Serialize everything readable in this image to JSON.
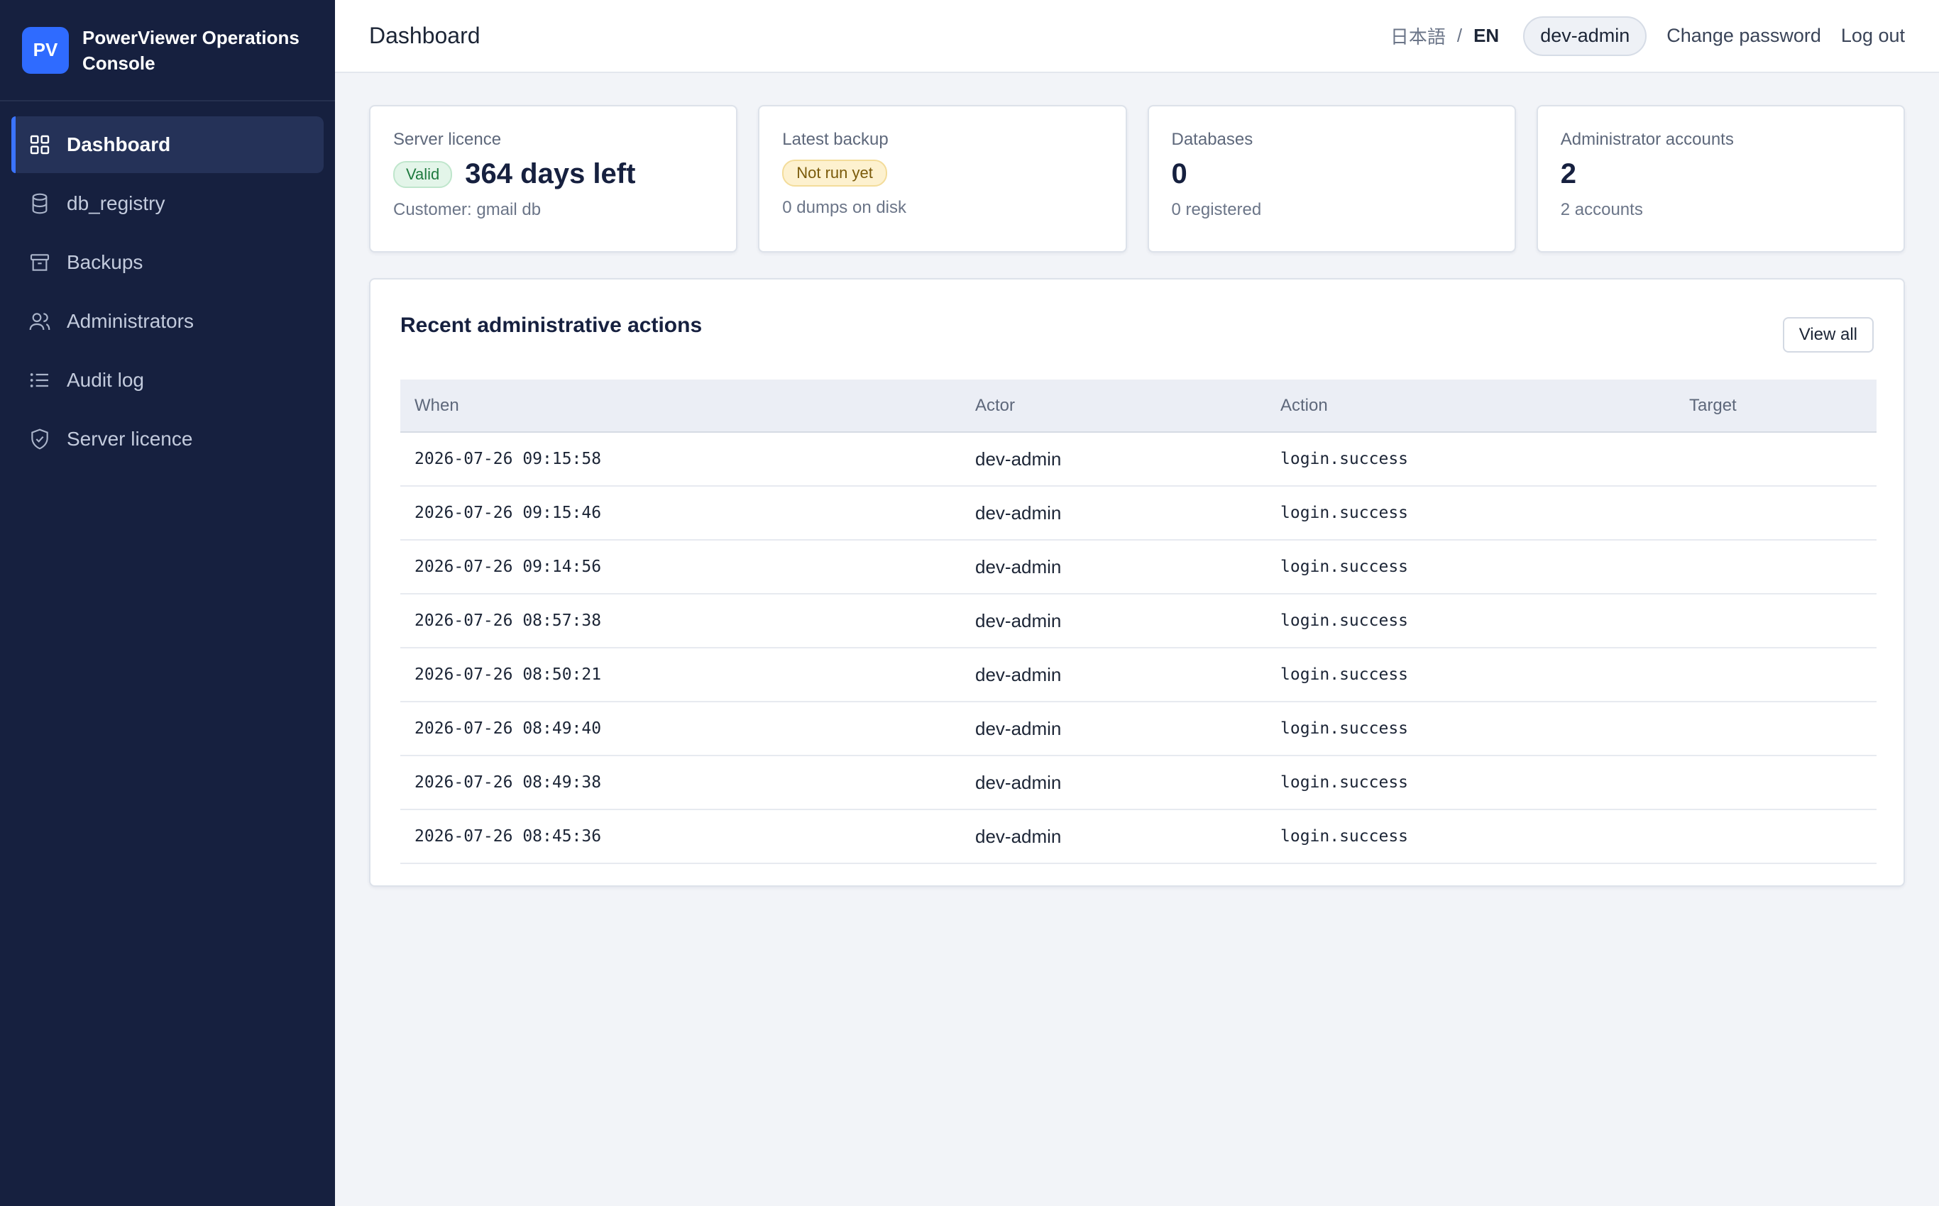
{
  "brand": {
    "logo_text": "PV",
    "name": "PowerViewer Operations Console"
  },
  "sidebar": {
    "items": [
      {
        "label": "Dashboard",
        "icon": "grid-icon",
        "active": true
      },
      {
        "label": "db_registry",
        "icon": "database-icon",
        "active": false
      },
      {
        "label": "Backups",
        "icon": "archive-icon",
        "active": false
      },
      {
        "label": "Administrators",
        "icon": "users-icon",
        "active": false
      },
      {
        "label": "Audit log",
        "icon": "list-icon",
        "active": false
      },
      {
        "label": "Server licence",
        "icon": "shield-check-icon",
        "active": false
      }
    ]
  },
  "header": {
    "title": "Dashboard",
    "lang_ja": "日本語",
    "lang_sep": "/",
    "lang_en": "EN",
    "user": "dev-admin",
    "change_password": "Change password",
    "logout": "Log out"
  },
  "cards": {
    "licence": {
      "label": "Server licence",
      "badge": "Valid",
      "value": "364 days left",
      "sub": "Customer: gmail db"
    },
    "backup": {
      "label": "Latest backup",
      "badge": "Not run yet",
      "sub": "0 dumps on disk"
    },
    "databases": {
      "label": "Databases",
      "value": "0",
      "sub": "0 registered"
    },
    "admins": {
      "label": "Administrator accounts",
      "value": "2",
      "sub": "2 accounts"
    }
  },
  "recent": {
    "title": "Recent administrative actions",
    "view_all": "View all",
    "columns": [
      "When",
      "Actor",
      "Action",
      "Target"
    ],
    "rows": [
      {
        "when": "2026-07-26 09:15:58",
        "actor": "dev-admin",
        "action": "login.success",
        "target": ""
      },
      {
        "when": "2026-07-26 09:15:46",
        "actor": "dev-admin",
        "action": "login.success",
        "target": ""
      },
      {
        "when": "2026-07-26 09:14:56",
        "actor": "dev-admin",
        "action": "login.success",
        "target": ""
      },
      {
        "when": "2026-07-26 08:57:38",
        "actor": "dev-admin",
        "action": "login.success",
        "target": ""
      },
      {
        "when": "2026-07-26 08:50:21",
        "actor": "dev-admin",
        "action": "login.success",
        "target": ""
      },
      {
        "when": "2026-07-26 08:49:40",
        "actor": "dev-admin",
        "action": "login.success",
        "target": ""
      },
      {
        "when": "2026-07-26 08:49:38",
        "actor": "dev-admin",
        "action": "login.success",
        "target": ""
      },
      {
        "when": "2026-07-26 08:45:36",
        "actor": "dev-admin",
        "action": "login.success",
        "target": ""
      }
    ]
  },
  "colors": {
    "sidebar_bg": "#16203f",
    "accent": "#2f6bff",
    "valid_badge": "#e3f5e9",
    "warn_badge": "#fdf1cf"
  }
}
